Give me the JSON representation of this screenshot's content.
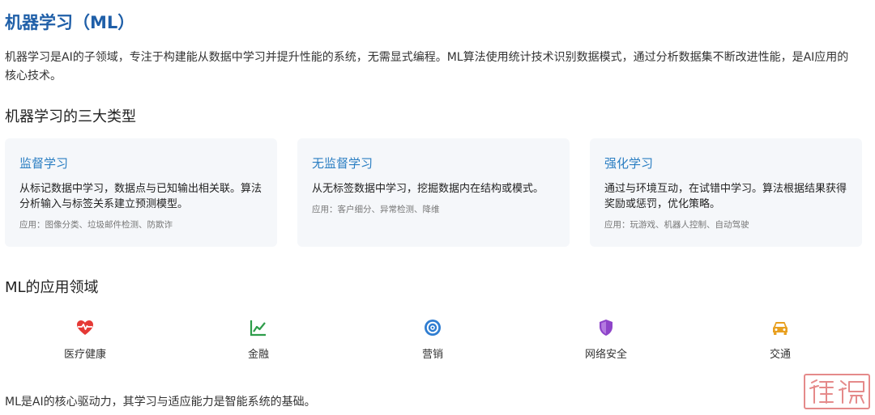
{
  "title": "机器学习（ML）",
  "intro": "机器学习是AI的子领域，专注于构建能从数据中学习并提升性能的系统，无需显式编程。ML算法使用统计技术识别数据模式，通过分析数据集不断改进性能，是AI应用的核心技术。",
  "types_section": {
    "heading": "机器学习的三大类型",
    "cards": [
      {
        "title": "监督学习",
        "desc": "从标记数据中学习，数据点与已知输出相关联。算法分析输入与标签关系建立预测模型。",
        "apps": "应用：图像分类、垃圾邮件检测、防欺诈"
      },
      {
        "title": "无监督学习",
        "desc": "从无标签数据中学习，挖掘数据内在结构或模式。",
        "apps": "应用：客户细分、异常检测、降维"
      },
      {
        "title": "强化学习",
        "desc": "通过与环境互动，在试错中学习。算法根据结果获得奖励或惩罚，优化策略。",
        "apps": "应用：玩游戏、机器人控制、自动驾驶"
      }
    ]
  },
  "apps_section": {
    "heading": "ML的应用领域",
    "items": [
      {
        "label": "医疗健康",
        "icon": "heartbeat-icon",
        "color": "#e53935"
      },
      {
        "label": "金融",
        "icon": "line-chart-icon",
        "color": "#2e9d4a"
      },
      {
        "label": "营销",
        "icon": "target-icon",
        "color": "#2f7dd1"
      },
      {
        "label": "网络安全",
        "icon": "shield-icon",
        "color": "#8e44c9"
      },
      {
        "label": "交通",
        "icon": "car-icon",
        "color": "#e8a020"
      }
    ]
  },
  "footer": "ML是AI的核心驱动力，其学习与适应能力是智能系统的基础。",
  "watermark": "传承"
}
